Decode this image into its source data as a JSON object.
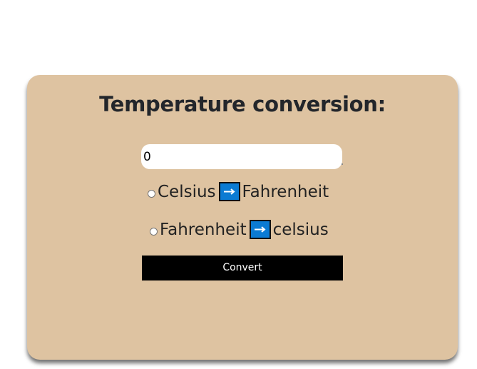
{
  "title": "Temperature conversion:",
  "input": {
    "value": "0",
    "placeholder": ""
  },
  "options": [
    {
      "from": "Celsius",
      "icon": "right-arrow-icon",
      "to": "Fahrenheit"
    },
    {
      "from": "Fahrenheit",
      "icon": "right-arrow-icon",
      "to": "celsius"
    }
  ],
  "convert_label": "Convert",
  "colors": {
    "card_background": "#dec3a1",
    "button_background": "#000000",
    "arrow_icon_background": "#0b7bd3"
  }
}
